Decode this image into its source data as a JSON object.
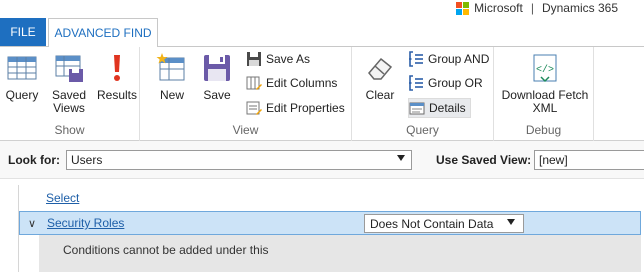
{
  "brand": {
    "company": "Microsoft",
    "separator": "|",
    "product": "Dynamics 365"
  },
  "tabs": [
    {
      "label": "FILE",
      "active": false
    },
    {
      "label": "ADVANCED FIND",
      "active": true
    }
  ],
  "ribbon": {
    "groups": {
      "show": {
        "label": "Show",
        "buttons": [
          {
            "label": "Query",
            "icon": "grid-icon"
          },
          {
            "label": "Saved Views",
            "line1": "Saved",
            "line2": "Views",
            "icon": "saved-views-icon"
          },
          {
            "label": "Results",
            "icon": "exclamation-icon"
          }
        ]
      },
      "view": {
        "label": "View",
        "buttons": [
          {
            "label": "New",
            "icon": "new-icon"
          },
          {
            "label": "Save",
            "icon": "save-disk-icon"
          }
        ],
        "small": [
          {
            "label": "Save As",
            "icon": "save-as-icon"
          },
          {
            "label": "Edit Columns",
            "icon": "edit-columns-icon"
          },
          {
            "label": "Edit Properties",
            "icon": "edit-properties-icon"
          }
        ]
      },
      "query": {
        "label": "Query",
        "buttons": [
          {
            "label": "Clear",
            "icon": "eraser-icon"
          }
        ],
        "small": [
          {
            "label": "Group AND",
            "icon": "group-and-icon"
          },
          {
            "label": "Group OR",
            "icon": "group-or-icon"
          },
          {
            "label": "Details",
            "icon": "details-icon"
          }
        ]
      },
      "debug": {
        "label": "Debug",
        "buttons": [
          {
            "label": "Download Fetch XML",
            "line1": "Download Fetch",
            "line2": "XML",
            "icon": "download-xml-icon"
          }
        ]
      }
    }
  },
  "look_for": {
    "label": "Look for:",
    "value": "Users"
  },
  "saved_view": {
    "label": "Use Saved View:",
    "value": "[new]"
  },
  "query": {
    "select_link": "Select",
    "condition": {
      "field": "Security Roles",
      "operator": "Does Not Contain Data"
    },
    "note": "Conditions cannot be added under this"
  }
}
